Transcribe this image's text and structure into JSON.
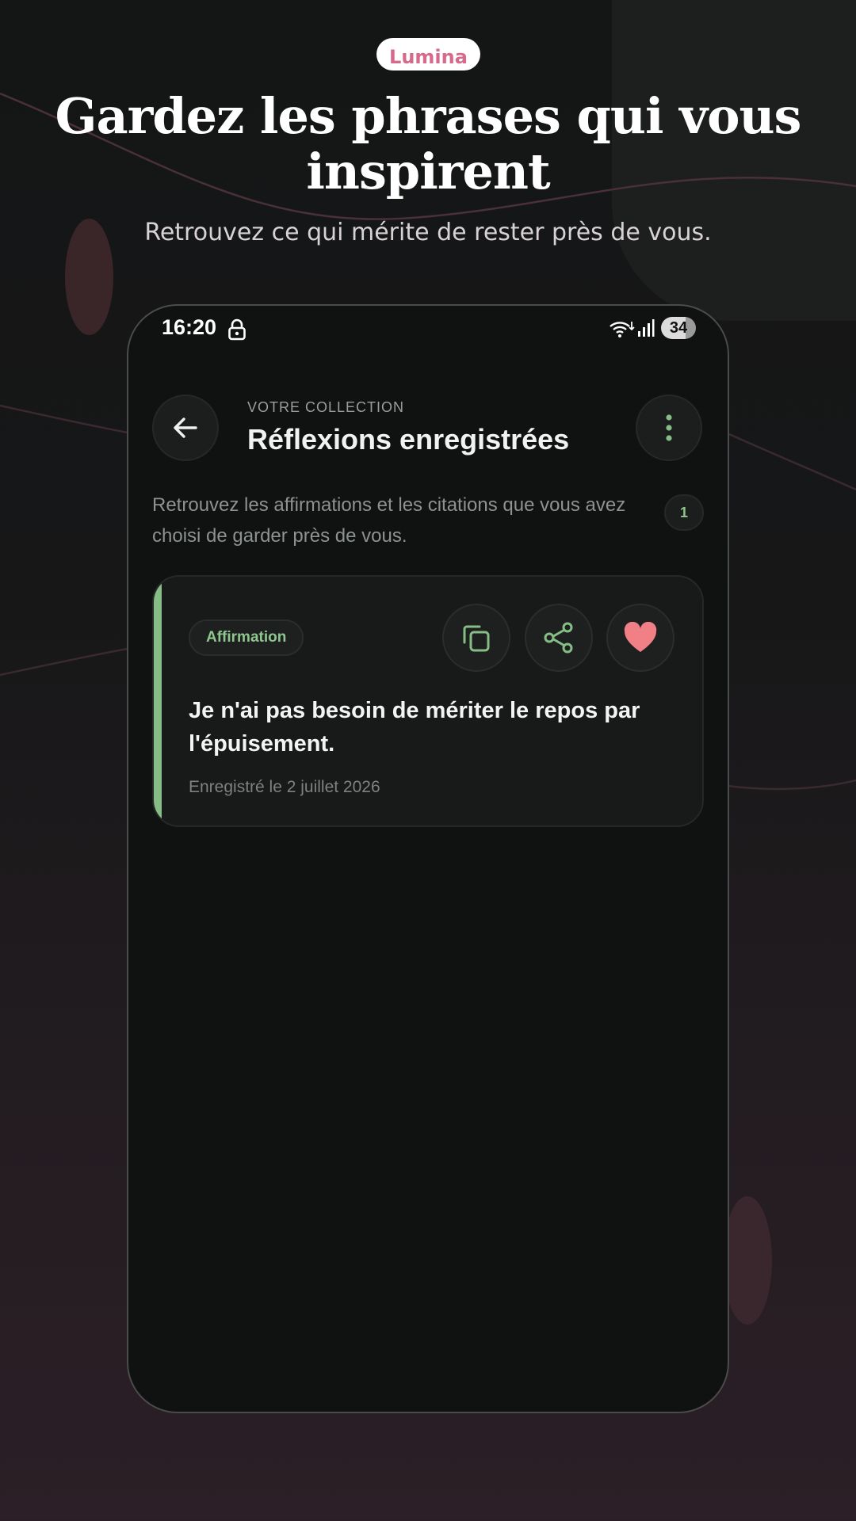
{
  "brand": {
    "name": "Lumina"
  },
  "promo": {
    "headline": "Gardez les phrases qui vous inspirent",
    "subheadline": "Retrouvez ce qui mérite de rester près de vous."
  },
  "status_bar": {
    "time": "16:20",
    "battery": "34",
    "icons": [
      "lock-icon",
      "wifi-icon",
      "signal-icon"
    ]
  },
  "header": {
    "eyebrow": "VOTRE COLLECTION",
    "title": "Réflexions enregistrées",
    "back_icon": "arrow-left-icon",
    "menu_icon": "more-vertical-icon"
  },
  "intro": {
    "text": "Retrouvez les affirmations et les citations que vous avez choisi de garder près de vous.",
    "count": "1"
  },
  "items": [
    {
      "tag": "Affirmation",
      "text": "Je n'ai pas besoin de mériter le repos par l'épuisement.",
      "saved": "Enregistré le 2 juillet 2026",
      "favorite": true,
      "actions": [
        "copy-icon",
        "share-icon",
        "heart-icon"
      ]
    }
  ],
  "colors": {
    "accent_green": "#86bd86",
    "heart_pink": "#f07f86",
    "brand_pink": "#d76a8c",
    "background": "#101212"
  }
}
